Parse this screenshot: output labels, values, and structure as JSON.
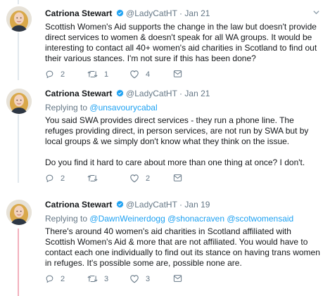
{
  "tweets": [
    {
      "name": "Catriona Stewart",
      "handle": "@LadyCatHT",
      "separator": "·",
      "date": "Jan 21",
      "reply_label": "",
      "reply_mentions": [],
      "text": [
        "Scottish Women's Aid supports the change in the law but doesn't provide direct services to women & doesn't speak for all WA groups. It would be interesting to contact all 40+ women's aid charities in Scotland to find out their various stances. I'm not sure if this has been done?"
      ],
      "replies": "2",
      "retweets": "1",
      "likes": "4"
    },
    {
      "name": "Catriona Stewart",
      "handle": "@LadyCatHT",
      "separator": "·",
      "date": "Jan 21",
      "reply_label": "Replying to",
      "reply_mentions": [
        "@unsavourycabal"
      ],
      "text": [
        "You said SWA provides direct services - they run a phone line. The refuges providing direct, in person services, are not run by SWA but by local groups & we simply don't know what they think on the issue.",
        "Do you find it hard to care about more than one thing at once? I don't."
      ],
      "replies": "2",
      "retweets": "",
      "likes": "2"
    },
    {
      "name": "Catriona Stewart",
      "handle": "@LadyCatHT",
      "separator": "·",
      "date": "Jan 19",
      "reply_label": "Replying to",
      "reply_mentions": [
        "@DawnWeinerdogg",
        "@shonacraven",
        "@scotwomensaid"
      ],
      "text": [
        "There's around 40 women's aid charities in Scotland affiliated with Scottish Women's Aid & more that are not affiliated. You would have to contact each one individually to find out its stance on having trans women in refuges. It's possible some are, possible none are."
      ],
      "replies": "2",
      "retweets": "3",
      "likes": "3"
    }
  ],
  "colors": {
    "link": "#1da1f2",
    "muted": "#657786",
    "verified": "#1da1f2",
    "thread_line": "#e1e8ed",
    "thread_line_highlight": "#f2b0bd"
  },
  "icons": [
    "verified-badge-icon",
    "chevron-down-icon",
    "reply-icon",
    "retweet-icon",
    "like-icon",
    "direct-message-icon"
  ]
}
